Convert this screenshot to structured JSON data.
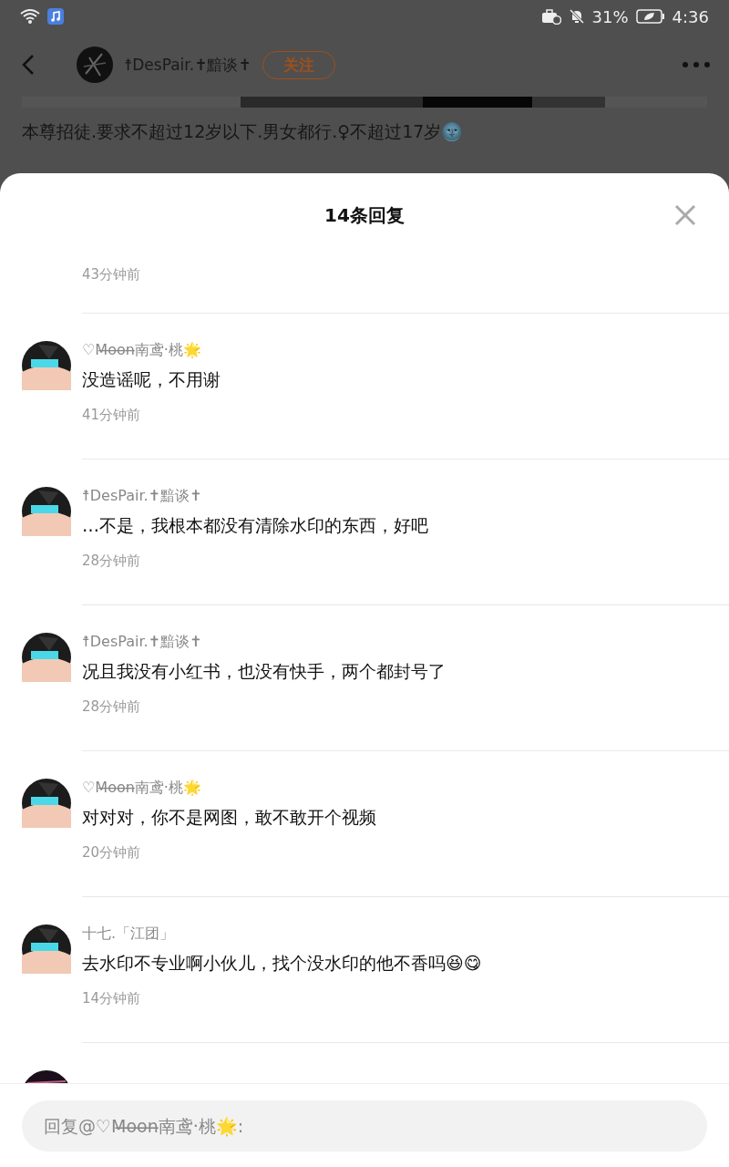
{
  "status_bar": {
    "battery": "31%",
    "time": "4:36"
  },
  "header": {
    "author": "☨DesPair.✝黯谈✝",
    "follow_button": "关注"
  },
  "post": {
    "text": "本尊招徒.要求不超过12岁以下.男女都行.♀不超过17岁🌚"
  },
  "sheet": {
    "title": "14条回复"
  },
  "comments": [
    {
      "time": "43分钟前"
    },
    {
      "name": "♡M̶o̶o̶n̶南鸢·桃🌟",
      "text": "没造谣呢，不用谢",
      "time": "41分钟前"
    },
    {
      "name": "☨DesPair.✝黯谈✝",
      "text": "…不是，我根本都没有清除水印的东西，好吧",
      "time": "28分钟前"
    },
    {
      "name": "☨DesPair.✝黯谈✝",
      "text": "况且我没有小红书，也没有快手，两个都封号了",
      "time": "28分钟前"
    },
    {
      "name": "♡M̶o̶o̶n̶南鸢·桃🌟",
      "text": "对对对，你不是网图，敢不敢开个视频",
      "time": "20分钟前"
    },
    {
      "name": "十七.「江团」",
      "text": "去水印不专业啊小伙儿，找个没水印的他不香吗😆😋",
      "time": "14分钟前"
    }
  ],
  "reply_field": {
    "placeholder": "回复@♡M̶o̶o̶n̶南鸢·桃🌟:"
  }
}
